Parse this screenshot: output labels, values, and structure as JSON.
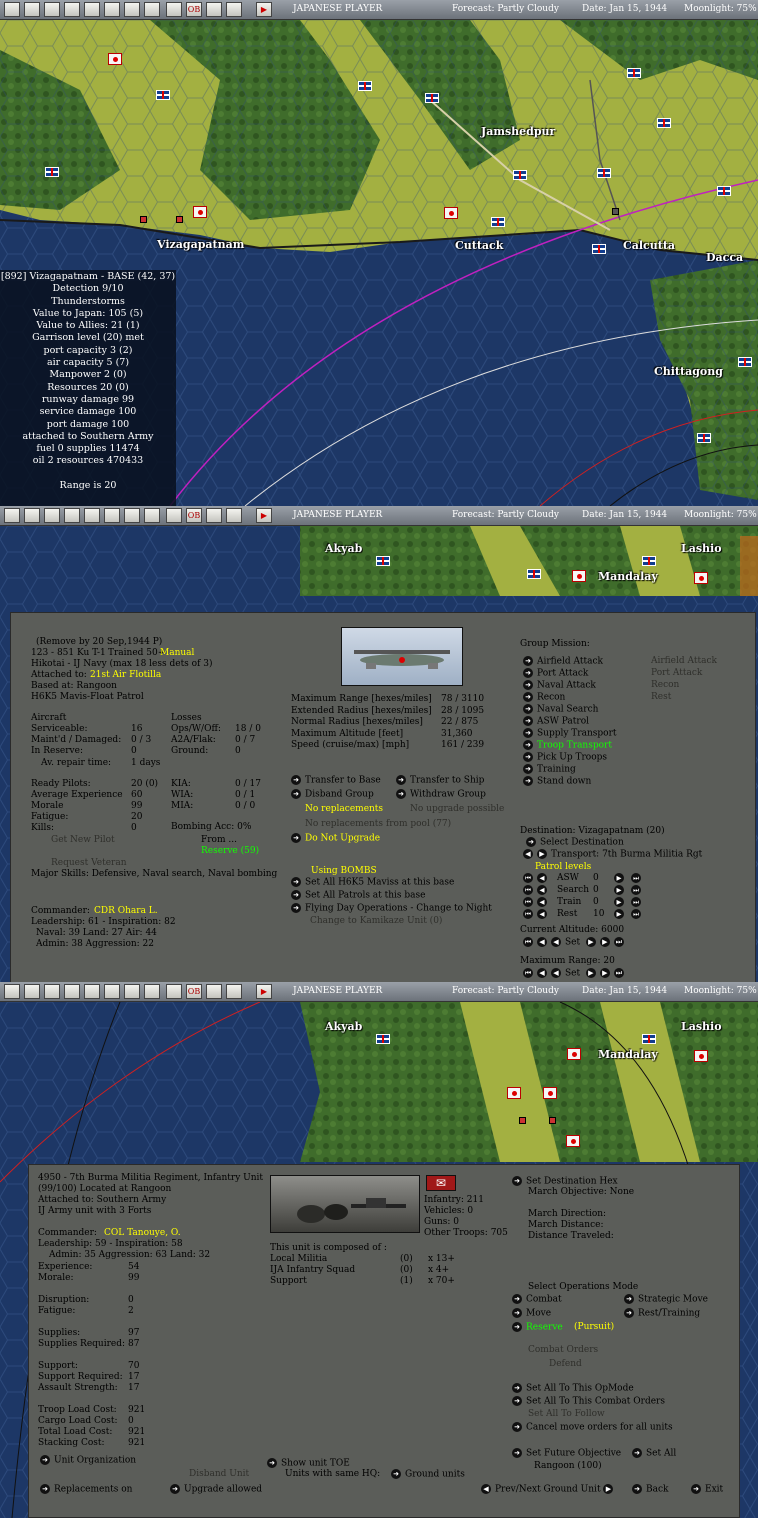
{
  "toolbar": {
    "icons": [
      "jp-flag-icon",
      "aircraft-icon",
      "naval-icon",
      "airfield-icon",
      "weather-icon",
      "industry-icon",
      "ground-icon",
      "globe-icon",
      "settings-icon",
      "ob-icon",
      "list-icon",
      "report-icon",
      "end-turn-icon"
    ],
    "ob_label": "OB",
    "player": "JAPANESE PLAYER",
    "forecast": "Forecast: Partly Cloudy",
    "date": "Date: Jan 15, 1944",
    "moonlight": "Moonlight: 75%"
  },
  "colors": {
    "map_land": "#9ca83a",
    "map_forest": "#3e6b2a",
    "ocean": "#1e3868",
    "panel": "#5b5d59",
    "highlight": "#ffff00",
    "active": "#22ff00"
  },
  "map1": {
    "labels": {
      "vizag": "Vizagapatnam",
      "jamshedpur": "Jamshedpur",
      "cuttack": "Cuttack",
      "calcutta": "Calcutta",
      "dacca": "Dacca",
      "chittagong": "Chittagong"
    },
    "info": [
      "[892] Vizagapatnam - BASE (42, 37)",
      "Detection 9/10",
      "Thunderstorms",
      "Value to Japan: 105 (5)",
      "Value to Allies: 21 (1)",
      "Garrison level (20) met",
      "port capacity 3 (2)",
      "air capacity 5 (7)",
      "Manpower 2 (0)",
      "Resources 20 (0)",
      "runway damage 99",
      "service damage 100",
      "port damage 100",
      "attached to Southern Army",
      "fuel 0 supplies 11474",
      "oil 2 resources 470433",
      "",
      "Range is 20"
    ]
  },
  "map2": {
    "labels": {
      "akyab": "Akyab",
      "lashio": "Lashio",
      "mandalay": "Mandalay"
    }
  },
  "air": {
    "header": [
      "(Remove by 20 Sep,1944 P)",
      "123 - 851 Ku T-1"
    ],
    "trained": "Trained 50+",
    "manual": "Manual",
    "navy": "Hikotai - IJ Navy (max 18 less dets of 3)",
    "attached_label": "Attached to:",
    "attached": "21st Air Flotilla",
    "based": "Based at: Rangoon",
    "type": "H6K5 Mavis-Float Patrol",
    "aircraft_rows": [
      [
        "Aircraft",
        ""
      ],
      [
        "Serviceable:",
        "16"
      ],
      [
        "Maint'd / Damaged:",
        "0 / 3"
      ],
      [
        "In Reserve:",
        "0"
      ]
    ],
    "repair": [
      "Av. repair time:",
      "1 days"
    ],
    "loss_rows": [
      [
        "Losses",
        ""
      ],
      [
        "Ops/W/Off:",
        "18 / 0"
      ],
      [
        "A2A/Flak:",
        "0 / 7"
      ],
      [
        "Ground:",
        "0"
      ]
    ],
    "pilot_rows": [
      [
        "Ready Pilots:",
        "20 (0)"
      ],
      [
        "Average Experience",
        "60"
      ],
      [
        "Morale",
        "99"
      ],
      [
        "Fatigue:",
        "20"
      ],
      [
        "Kills:",
        "0"
      ]
    ],
    "kia_rows": [
      [
        "KIA:",
        "0 / 17"
      ],
      [
        "WIA:",
        "0 / 1"
      ],
      [
        "MIA:",
        "0 / 0"
      ]
    ],
    "bombing": "Bombing Acc: 0%",
    "get_pilot": "Get New Pilot",
    "from": "From ...",
    "reserve": "Reserve (59)",
    "request": "Request Veteran",
    "skills": "Major Skills: Defensive, Naval search, Naval bombing",
    "commander_label": "Commander:",
    "commander": "CDR Ohara L.",
    "leadership": "Leadership: 61 - Inspiration: 82",
    "naval": "Naval: 39  Land: 27  Air: 44",
    "admin": "Admin: 38  Aggression: 22",
    "specs": [
      [
        "Maximum Range [hexes/miles]",
        "78 / 3110"
      ],
      [
        "Extended Radius [hexes/miles]",
        "28 / 1095"
      ],
      [
        "Normal Radius [hexes/miles]",
        "22 / 875"
      ],
      [
        "Maximum Altitude [feet]",
        "31,360"
      ],
      [
        "Speed (cruise/max) [mph]",
        "161 / 239"
      ]
    ],
    "transfer_base": "Transfer to Base",
    "transfer_ship": "Transfer to Ship",
    "disband": "Disband Group",
    "withdraw": "Withdraw Group",
    "no_repl": "No replacements",
    "no_upgrade": "No upgrade possible",
    "no_repl_pool": "No replacements from pool (77)",
    "do_not_upgrade": "Do Not Upgrade",
    "using_bombs": "Using BOMBS",
    "set_mavis": "Set All H6K5 Maviss at this base",
    "set_patrols": "Set All Patrols at this base",
    "flying": "Flying Day Operations - Change to Night",
    "kamikaze": "Change to Kamikaze Unit (0)",
    "mission_title": "Group Mission:",
    "missions": [
      "Airfield Attack",
      "Port Attack",
      "Naval Attack",
      "Recon",
      "Naval Search",
      "ASW Patrol",
      "Supply Transport",
      "Troop Transport",
      "Pick Up Troops",
      "Training",
      "Stand down"
    ],
    "missions_alt": [
      "Airfield Attack",
      "Port Attack",
      "Recon",
      "Rest"
    ],
    "dest": "Destination: Vizagapatnam  (20)",
    "select_dest": "Select Destination",
    "transport": "Transport: 7th Burma Militia Rgt",
    "patrol_title": "Patrol levels",
    "patrol": [
      [
        "ASW",
        "0"
      ],
      [
        "Search",
        "0"
      ],
      [
        "Train",
        "0"
      ],
      [
        "Rest",
        "10"
      ]
    ],
    "altitude": "Current Altitude: 6000",
    "max_range": "Maximum Range: 20",
    "set": "Set"
  },
  "ground": {
    "title": "4950 - 7th Burma Militia Regiment, Infantry Unit",
    "located": "(99/100) Located at Rangoon",
    "attached": "Attached to: Southern Army",
    "ija": "IJ Army unit with 3 Forts",
    "commander_label": "Commander:",
    "commander": "COL Tanouye, O.",
    "leadership": "Leadership: 59 - Inspiration: 58",
    "admin": "Admin: 35  Aggression: 63  Land: 32",
    "stats1": [
      [
        "Experience:",
        "54"
      ],
      [
        "Morale:",
        "99"
      ]
    ],
    "stats2": [
      [
        "Disruption:",
        "0"
      ],
      [
        "Fatigue:",
        "2"
      ]
    ],
    "stats3": [
      [
        "Supplies:",
        "97"
      ],
      [
        "Supplies Required:",
        "87"
      ]
    ],
    "stats4": [
      [
        "Support:",
        "70"
      ],
      [
        "Support Required:",
        "17"
      ],
      [
        "Assault Strength:",
        "17"
      ]
    ],
    "stats5": [
      [
        "Troop Load Cost:",
        "921"
      ],
      [
        "Cargo Load Cost:",
        "0"
      ],
      [
        "Total Load Cost:",
        "921"
      ],
      [
        "Stacking Cost:",
        "921"
      ]
    ],
    "counts": [
      "Infantry: 211",
      "Vehicles: 0",
      "Guns: 0",
      "Other Troops: 705"
    ],
    "composed": "This unit is composed of :",
    "components": [
      [
        "Local Militia",
        "(0)",
        "x 13+"
      ],
      [
        "IJA Infantry Squad",
        "(0)",
        "x 4+"
      ],
      [
        "Support",
        "(1)",
        "x 70+"
      ]
    ],
    "set_dest": "Set Destination Hex",
    "march_obj": "March Objective: None",
    "march_dir": "March Direction:",
    "march_dist": "March Distance:",
    "dist_trav": "Distance Traveled:",
    "ops_title": "Select Operations Mode",
    "combat": "Combat",
    "strategic": "Strategic Move",
    "move": "Move",
    "rest": "Rest/Training",
    "reserve": "Reserve",
    "pursuit": "(Pursuit)",
    "combat_orders": "Combat Orders",
    "defend": "Defend",
    "set_opmode": "Set All To This OpMode",
    "set_orders": "Set All To This Combat Orders",
    "set_follow": "Set All To Follow",
    "cancel": "Cancel move orders for all units",
    "future": "Set Future Objective",
    "set_all": "Set All",
    "rangoon": "Rangoon (100)",
    "unit_org": "Unit Organization",
    "disband": "Disband Unit",
    "toe": "Show unit TOE",
    "same_hq": "Units with same HQ:",
    "ground_units": "Ground units",
    "repl_on": "Replacements on",
    "upgrade": "Upgrade allowed",
    "prev_next": "Prev/Next Ground Unit",
    "back": "Back",
    "exit": "Exit"
  }
}
